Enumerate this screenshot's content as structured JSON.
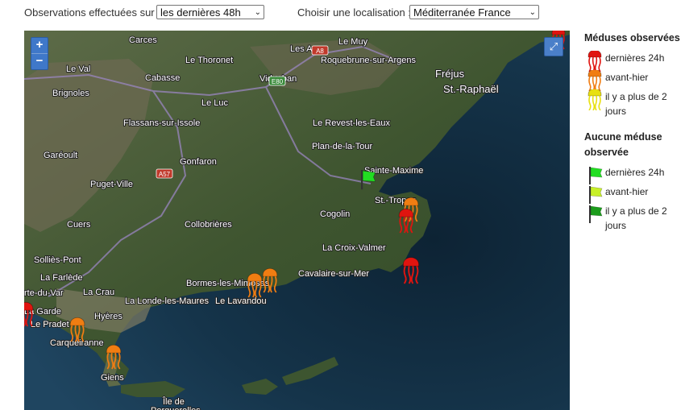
{
  "controls": {
    "period_label": "Observations effectuées sur :",
    "period_value": "les dernières 48h",
    "location_label": "Choisir une localisation :",
    "location_value": "Méditerranée France"
  },
  "map": {
    "zoom_in": "+",
    "zoom_out": "−",
    "fullscreen_icon": "expand-icon",
    "places": [
      "Carces",
      "Le Muy",
      "Les Arcs",
      "Le Val",
      "Le Thoronet",
      "Roquebrune-sur-Argens",
      "Fréjus",
      "St.-Raphaël",
      "Brignoles",
      "Cabasse",
      "Vidauban",
      "Le Luc",
      "Flassans-sur-Issole",
      "Le Revest-les-Eaux",
      "Plan-de-la-Tour",
      "Garéoult",
      "Gonfaron",
      "Sainte-Maxime",
      "Puget-Ville",
      "St.-Tropez",
      "Cogolin",
      "Cuers",
      "Collobrières",
      "La Croix-Valmer",
      "Solliès-Pont",
      "La Farlède",
      "Cavalaire-sur-Mer",
      "rte-du-Var",
      "La Crau",
      "Bormes-les-Mimosas",
      "La Londe-les-Maures",
      "Le Lavandou",
      "La Garde",
      "Hyères",
      "Le Pradet",
      "Carqueiranne",
      "Giens",
      "Île de",
      "Porquerolles"
    ],
    "roads": [
      "A8",
      "E80",
      "A57"
    ]
  },
  "legend": {
    "observed_title": "Méduses observées",
    "observed": [
      {
        "label": "dernières 24h",
        "color": "#e0140f"
      },
      {
        "label": "avant-hier",
        "color": "#f07d12"
      },
      {
        "label": "il y a plus de 2 jours",
        "color": "#e8e010"
      }
    ],
    "none_title": "Aucune méduse observée",
    "none": [
      {
        "label": "dernières 24h",
        "color": "#22dd22"
      },
      {
        "label": "avant-hier",
        "color": "#c8f028"
      },
      {
        "label": "il y a plus de 2 jours",
        "color": "#1c9c1c"
      }
    ]
  }
}
